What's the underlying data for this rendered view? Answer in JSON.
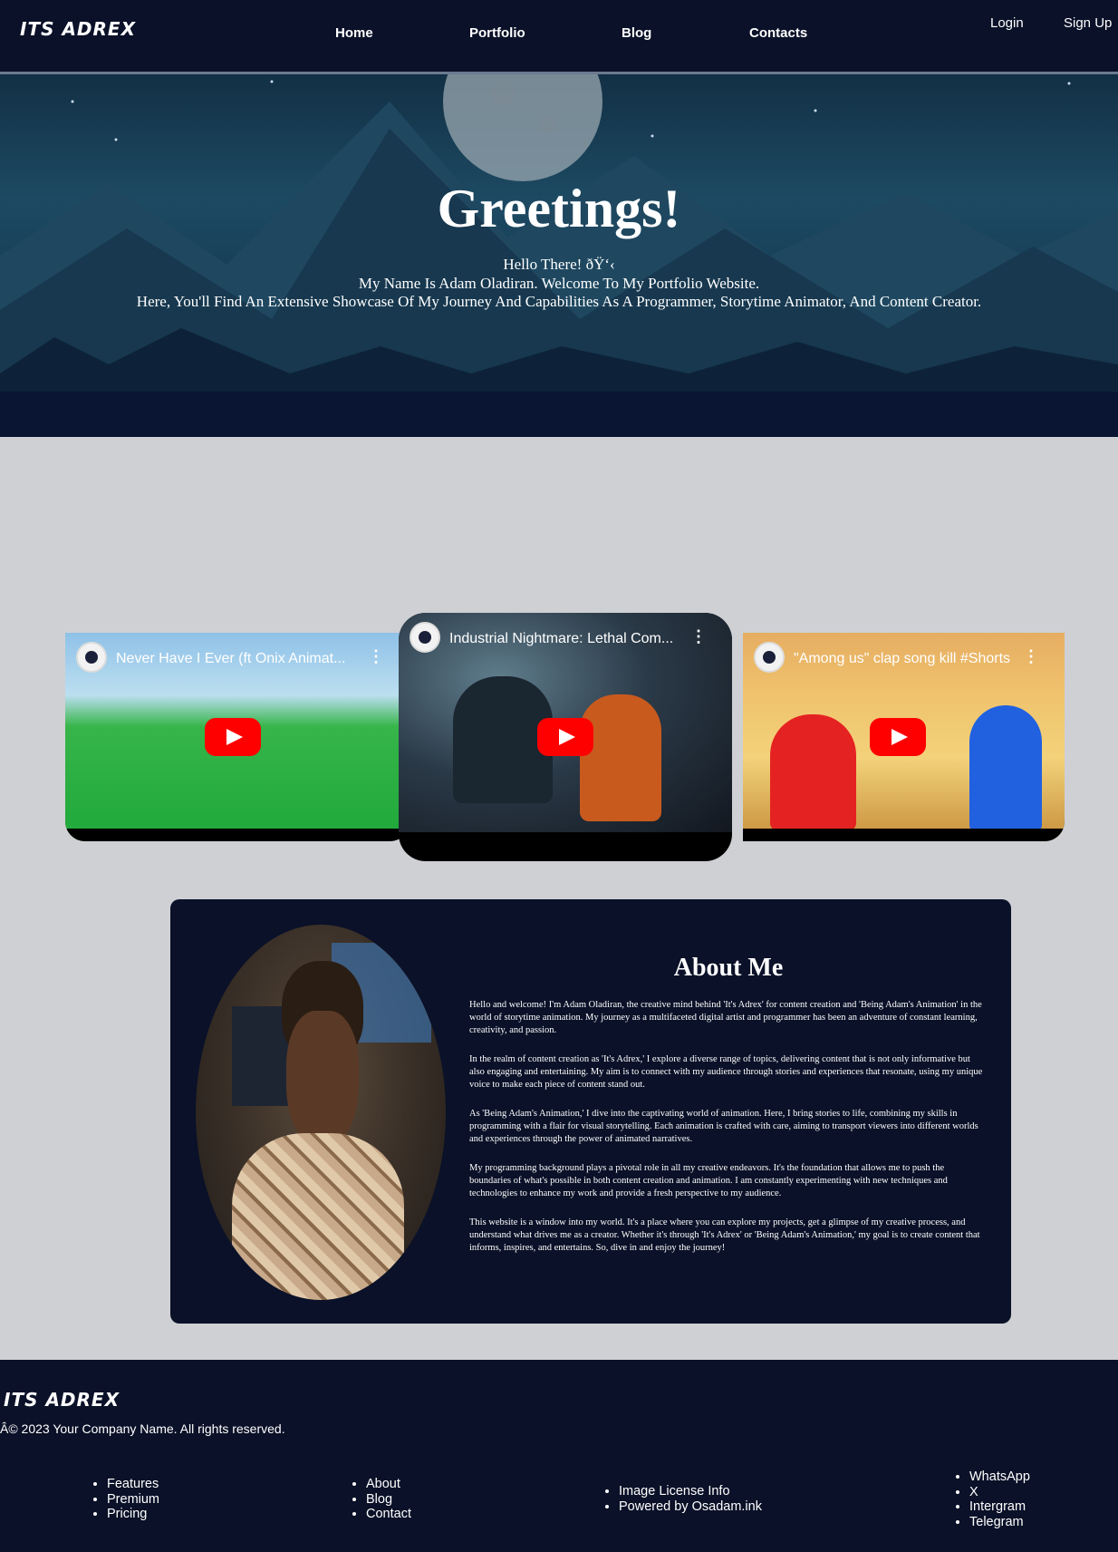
{
  "nav": {
    "logo": "ITS ADREX",
    "links": [
      {
        "label": "Home"
      },
      {
        "label": "Portfolio"
      },
      {
        "label": "Blog"
      },
      {
        "label": "Contacts"
      }
    ],
    "login": "Login",
    "signup": "Sign Up"
  },
  "hero": {
    "title": "Greetings!",
    "line1": "Hello There! ðŸ‘‹",
    "line2": "My Name Is Adam Oladiran. Welcome To My Portfolio Website.",
    "line3": "Here, You'll Find An Extensive Showcase Of My Journey And Capabilities As A Programmer, Storytime Animator, And Content Creator."
  },
  "videos": [
    {
      "title": "Never Have I Ever (ft Onix Animat..."
    },
    {
      "title": "Industrial Nightmare: Lethal Com..."
    },
    {
      "title": "\"Among us\" clap song kill #Shorts"
    }
  ],
  "about": {
    "title": "About Me",
    "paragraphs": [
      "Hello and welcome! I'm Adam Oladiran, the creative mind behind 'It's Adrex' for content creation and 'Being Adam's Animation' in the world of storytime animation. My journey as a multifaceted digital artist and programmer has been an adventure of constant learning, creativity, and passion.",
      "In the realm of content creation as 'It's Adrex,' I explore a diverse range of topics, delivering content that is not only informative but also engaging and entertaining. My aim is to connect with my audience through stories and experiences that resonate, using my unique voice to make each piece of content stand out.",
      "As 'Being Adam's Animation,' I dive into the captivating world of animation. Here, I bring stories to life, combining my skills in programming with a flair for visual storytelling. Each animation is crafted with care, aiming to transport viewers into different worlds and experiences through the power of animated narratives.",
      "My programming background plays a pivotal role in all my creative endeavors. It's the foundation that allows me to push the boundaries of what's possible in both content creation and animation. I am constantly experimenting with new techniques and technologies to enhance my work and provide a fresh perspective to my audience.",
      "This website is a window into my world. It's a place where you can explore my projects, get a glimpse of my creative process, and understand what drives me as a creator. Whether it's through 'It's Adrex' or 'Being Adam's Animation,' my goal is to create content that informs, inspires, and entertains. So, dive in and enjoy the journey!"
    ]
  },
  "footer": {
    "logo": "ITS ADREX",
    "copyright": "Â© 2023 Your Company Name. All rights reserved.",
    "col1": [
      "Features",
      "Premium",
      "Pricing"
    ],
    "col2": [
      "About",
      "Blog",
      "Contact"
    ],
    "col3": [
      "Image License Info",
      "Powered by Osadam.ink"
    ],
    "col4": [
      "WhatsApp",
      "X",
      "Intergram",
      "Telegram"
    ]
  }
}
